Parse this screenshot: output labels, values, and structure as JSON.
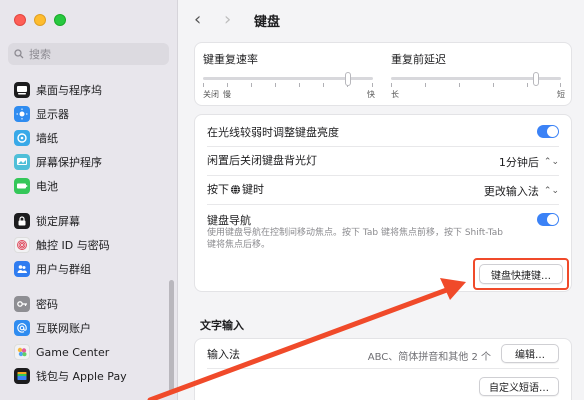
{
  "sidebar": {
    "search_placeholder": "搜索",
    "items": [
      {
        "label": "桌面与程序坞",
        "icon": "dock-icon",
        "color": "#1c1c1e"
      },
      {
        "label": "显示器",
        "icon": "display-icon",
        "color": "#2f8cf0"
      },
      {
        "label": "墙纸",
        "icon": "wallpaper-icon",
        "color": "#38a9e8"
      },
      {
        "label": "屏幕保护程序",
        "icon": "screensaver-icon",
        "color": "#4fbfd8"
      },
      {
        "label": "电池",
        "icon": "battery-icon",
        "color": "#34c759"
      },
      {
        "label": "锁定屏幕",
        "icon": "lock-icon",
        "color": "#1c1c1e"
      },
      {
        "label": "触控 ID 与密码",
        "icon": "touch-id-icon",
        "color": "#f2f2f4"
      },
      {
        "label": "用户与群组",
        "icon": "users-icon",
        "color": "#2f7cf0"
      },
      {
        "label": "密码",
        "icon": "key-icon",
        "color": "#8e8e93"
      },
      {
        "label": "互联网账户",
        "icon": "at-icon",
        "color": "#2f8cf0"
      },
      {
        "label": "Game Center",
        "icon": "game-center-icon",
        "color": "#f2f2f4"
      },
      {
        "label": "钱包与 Apple Pay",
        "icon": "wallet-icon",
        "color": "#1c1c1e"
      }
    ]
  },
  "header": {
    "title": "键盘",
    "back": "‹",
    "forward": "›"
  },
  "repeat": {
    "rate_label": "键重复速率",
    "rate_left": "关闭",
    "rate_left2": "慢",
    "rate_right": "快",
    "rate_value": 0.85,
    "delay_label": "重复前延迟",
    "delay_left": "长",
    "delay_right": "短",
    "delay_value": 0.85
  },
  "settings": {
    "auto_brightness": "在光线较弱时调整键盘亮度",
    "backlight_off": "闲置后关闭键盘背光灯",
    "backlight_value": "1分钟后",
    "press_key_prefix": "按下",
    "press_key_suffix": "键时",
    "press_key_value": "更改输入法",
    "nav_label": "键盘导航",
    "nav_desc1": "使用键盘导航在控制间移动焦点。按下 Tab 键将焦点前移，按下 Shift-Tab",
    "nav_desc2": "键将焦点后移。",
    "shortcuts_button": "键盘快捷键…"
  },
  "text_input": {
    "section_title": "文字输入",
    "input_method_label": "输入法",
    "input_method_value": "ABC、简体拼音和其他 2 个",
    "edit_button": "编辑…",
    "custom_phrases_button": "自定义短语…"
  },
  "colors": {
    "accent": "#3b82f6",
    "highlight": "#f04a2a"
  }
}
